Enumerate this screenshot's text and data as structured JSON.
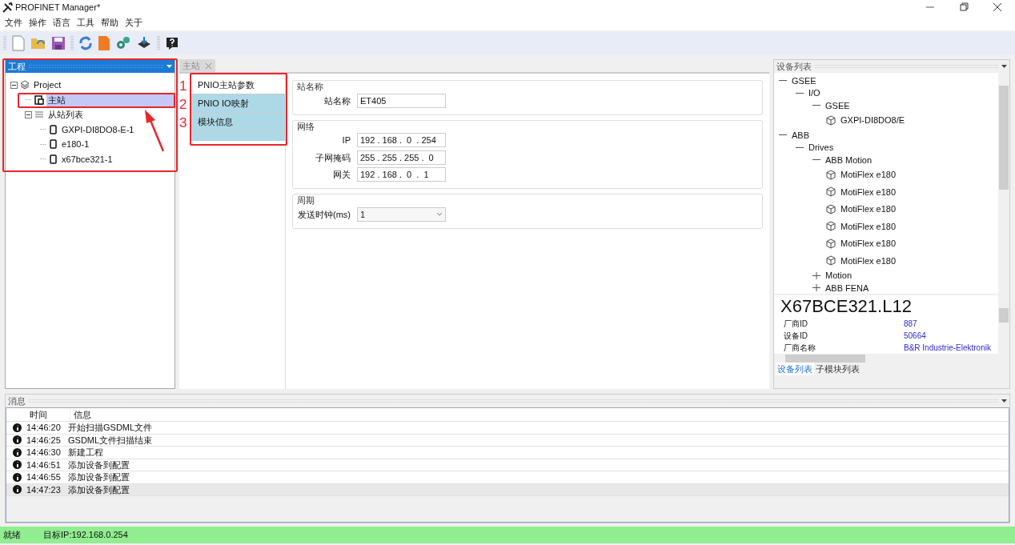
{
  "window": {
    "title": "PROFINET Manager*"
  },
  "menu": [
    "文件",
    "操作",
    "语言",
    "工具",
    "帮助",
    "关于"
  ],
  "project_panel": {
    "title": "工程",
    "tree": [
      {
        "label": "Project",
        "kind": "project",
        "expanded": true,
        "selected": false,
        "children": [
          {
            "label": "主站",
            "kind": "master",
            "selected": true
          },
          {
            "label": "从站列表",
            "kind": "list",
            "expanded": true,
            "selected": false,
            "children": [
              {
                "label": "GXPI-DI8DO8-E-1",
                "kind": "device",
                "selected": false
              },
              {
                "label": "e180-1",
                "kind": "device",
                "selected": false
              },
              {
                "label": "x67bce321-1",
                "kind": "device",
                "selected": false
              }
            ]
          }
        ]
      }
    ]
  },
  "editor": {
    "tabs": [
      {
        "label": "主站",
        "selected": true
      }
    ],
    "nav": [
      {
        "label": "PNIO主站参数",
        "selected": true
      },
      {
        "label": "PNIO IO映射",
        "selected": false
      },
      {
        "label": "模块信息",
        "selected": false
      }
    ],
    "groups": [
      {
        "title": "站名称",
        "fields": [
          {
            "label": "站名称",
            "value": "ET405",
            "kind": "text"
          }
        ]
      },
      {
        "title": "网络",
        "fields": [
          {
            "label": "IP",
            "value": "192 . 168 .  0  . 254",
            "kind": "ip"
          },
          {
            "label": "子网掩码",
            "value": "255 . 255 . 255 .  0",
            "kind": "ip"
          },
          {
            "label": "网关",
            "value": "192 . 168 .  0  .  1",
            "kind": "ip"
          }
        ]
      },
      {
        "title": "周期",
        "fields": [
          {
            "label": "发送时钟(ms)",
            "value": "1",
            "kind": "select"
          }
        ]
      }
    ]
  },
  "annotations": {
    "numbers": [
      "1",
      "2",
      "3"
    ]
  },
  "device_panel": {
    "title": "设备列表",
    "tree": [
      {
        "label": "GSEE",
        "expanded": true,
        "children": [
          {
            "label": "I/O",
            "expanded": true,
            "children": [
              {
                "label": "GSEE",
                "expanded": true,
                "children": [
                  {
                    "label": "GXPI-DI8DO8/E"
                  }
                ]
              }
            ]
          }
        ]
      },
      {
        "label": "ABB",
        "expanded": true,
        "children": [
          {
            "label": "Drives",
            "expanded": true,
            "children": [
              {
                "label": "ABB Motion",
                "expanded": true,
                "children": [
                  {
                    "label": "MotiFlex e180"
                  },
                  {
                    "label": "MotiFlex e180"
                  },
                  {
                    "label": "MotiFlex e180"
                  },
                  {
                    "label": "MotiFlex e180"
                  },
                  {
                    "label": "MotiFlex e180"
                  },
                  {
                    "label": "MotiFlex e180"
                  }
                ]
              },
              {
                "label": "Motion",
                "expanded": false
              },
              {
                "label": "ABB FENA",
                "expanded": false
              }
            ]
          }
        ]
      }
    ],
    "info": {
      "title": "X67BCE321.L12",
      "rows": [
        {
          "label": "厂商ID",
          "value": "887"
        },
        {
          "label": "设备ID",
          "value": "50664"
        },
        {
          "label": "厂商名称",
          "value": "B&R Industrie-Elektronik"
        }
      ]
    },
    "tabs": [
      {
        "label": "设备列表",
        "selected": true
      },
      {
        "label": "子模块列表",
        "selected": false
      }
    ]
  },
  "messages": {
    "title": "消息",
    "columns": [
      "时间",
      "信息"
    ],
    "rows": [
      {
        "time": "14:46:20",
        "text": "开始扫描GSDML文件",
        "selected": false
      },
      {
        "time": "14:46:25",
        "text": "GSDML文件扫描结束",
        "selected": false
      },
      {
        "time": "14:46:30",
        "text": "新建工程",
        "selected": false
      },
      {
        "time": "14:46:51",
        "text": "添加设备到配置",
        "selected": false
      },
      {
        "time": "14:46:55",
        "text": "添加设备到配置",
        "selected": false
      },
      {
        "time": "14:47:23",
        "text": "添加设备到配置",
        "selected": true
      }
    ]
  },
  "status_bar": [
    "就绪",
    "目标IP:192.168.0.254"
  ]
}
